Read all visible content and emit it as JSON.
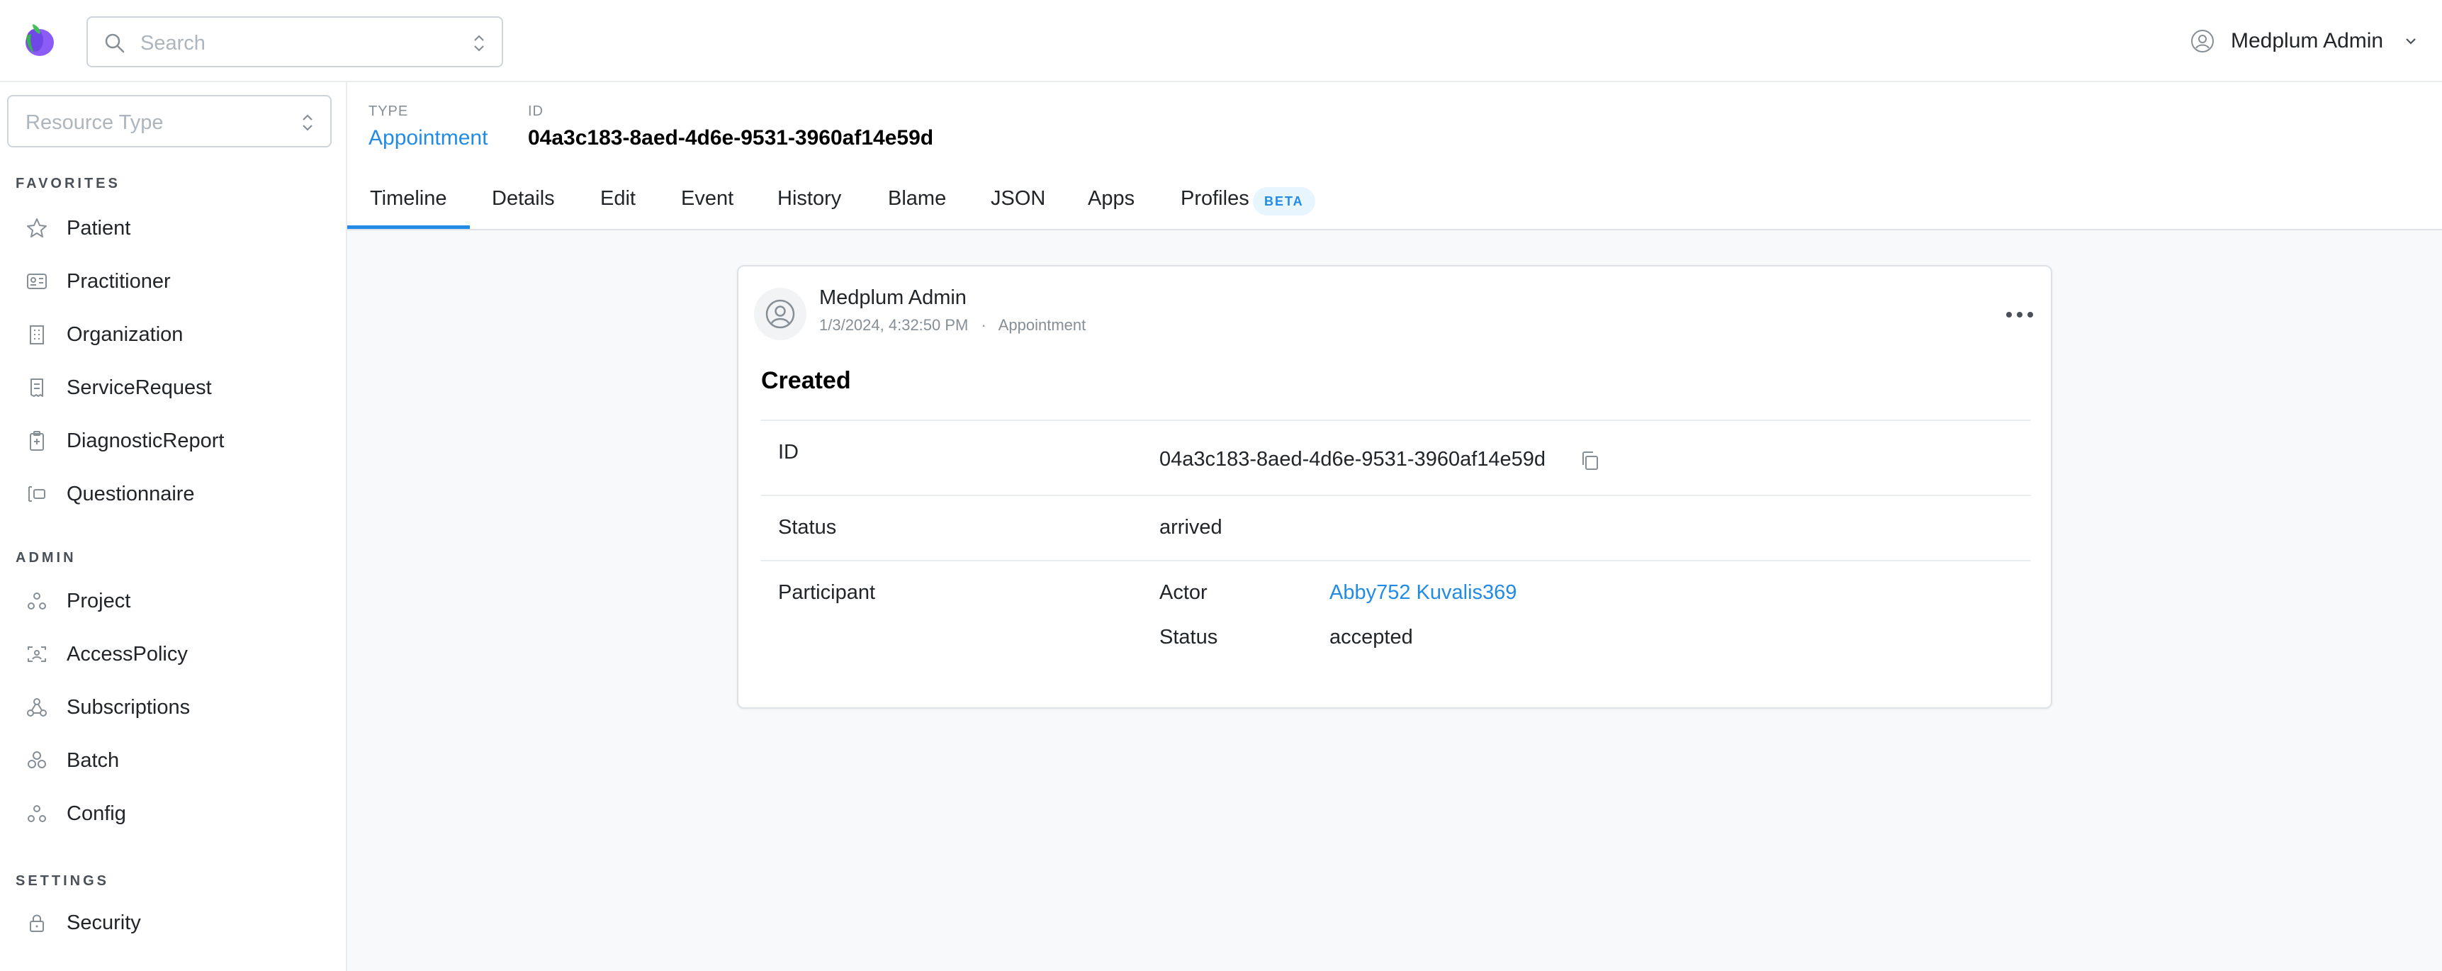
{
  "header": {
    "search_placeholder": "Search",
    "user_name": "Medplum Admin"
  },
  "sidebar": {
    "resource_type_placeholder": "Resource Type",
    "sections": {
      "favorites": "FAVORITES",
      "admin": "ADMIN",
      "settings": "SETTINGS"
    },
    "favorites": [
      {
        "label": "Patient",
        "icon": "star-icon"
      },
      {
        "label": "Practitioner",
        "icon": "id-card-icon"
      },
      {
        "label": "Organization",
        "icon": "building-icon"
      },
      {
        "label": "ServiceRequest",
        "icon": "receipt-icon"
      },
      {
        "label": "DiagnosticReport",
        "icon": "clipboard-icon"
      },
      {
        "label": "Questionnaire",
        "icon": "form-icon"
      }
    ],
    "admin": [
      {
        "label": "Project",
        "icon": "project-icon"
      },
      {
        "label": "AccessPolicy",
        "icon": "face-scan-icon"
      },
      {
        "label": "Subscriptions",
        "icon": "webhook-icon"
      },
      {
        "label": "Batch",
        "icon": "batch-icon"
      },
      {
        "label": "Config",
        "icon": "config-icon"
      }
    ],
    "settings": [
      {
        "label": "Security",
        "icon": "lock-icon"
      }
    ]
  },
  "resource": {
    "type_label": "TYPE",
    "type_value": "Appointment",
    "id_label": "ID",
    "id_value": "04a3c183-8aed-4d6e-9531-3960af14e59d"
  },
  "tabs": [
    {
      "label": "Timeline",
      "active": true
    },
    {
      "label": "Details"
    },
    {
      "label": "Edit"
    },
    {
      "label": "Event"
    },
    {
      "label": "History"
    },
    {
      "label": "Blame"
    },
    {
      "label": "JSON"
    },
    {
      "label": "Apps"
    },
    {
      "label": "Profiles",
      "badge": "BETA"
    }
  ],
  "card": {
    "author": "Medplum Admin",
    "timestamp": "1/3/2024, 4:32:50 PM",
    "separator": "·",
    "resource_type": "Appointment",
    "heading": "Created",
    "rows": {
      "id_label": "ID",
      "id_value": "04a3c183-8aed-4d6e-9531-3960af14e59d",
      "status_label": "Status",
      "status_value": "arrived",
      "participant_label": "Participant",
      "actor_label": "Actor",
      "actor_value": "Abby752 Kuvalis369",
      "participant_status_label": "Status",
      "participant_status_value": "accepted"
    }
  },
  "colors": {
    "accent": "#228be6",
    "border": "#dee2e6",
    "page_bg": "#f8f9fa"
  }
}
